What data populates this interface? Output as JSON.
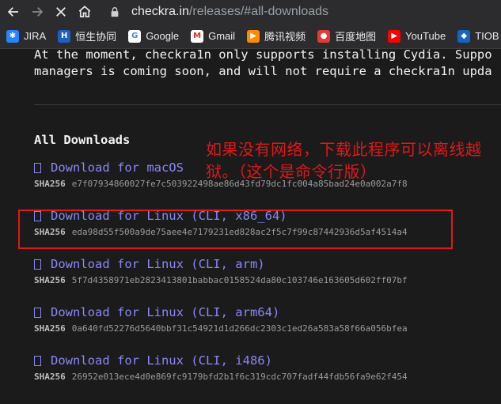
{
  "browser": {
    "url_host": "checkra.in",
    "url_path": "/releases/#all-downloads",
    "bookmarks": [
      {
        "label": "JIRA",
        "icon": "jira-icon",
        "color": "#2684ff",
        "glyph": "✱"
      },
      {
        "label": "恒生协同",
        "icon": "hengsheng-icon",
        "color": "#1f5fbf",
        "glyph": "H"
      },
      {
        "label": "Google",
        "icon": "google-icon",
        "color": "#ffffff",
        "glyph": "G"
      },
      {
        "label": "Gmail",
        "icon": "gmail-icon",
        "color": "#ffffff",
        "glyph": "M"
      },
      {
        "label": "腾讯视频",
        "icon": "tencent-video-icon",
        "color": "#ff8a00",
        "glyph": "▶"
      },
      {
        "label": "百度地图",
        "icon": "baidu-map-icon",
        "color": "#e53935",
        "glyph": "●"
      },
      {
        "label": "YouTube",
        "icon": "youtube-icon",
        "color": "#ff0000",
        "glyph": "▶"
      },
      {
        "label": "TIOB",
        "icon": "tiobe-icon",
        "color": "#1565c0",
        "glyph": "◆"
      }
    ]
  },
  "page": {
    "intro_line1": "At the moment, checkra1n only supports installing Cydia. Suppo",
    "intro_line2": "managers is coming soon, and will not require a checkra1n upda",
    "heading": "All Downloads",
    "annotation": "如果没有网络，下载此程序可以离线越狱。（这个是命令行版）",
    "hash_label": "SHA256",
    "downloads": [
      {
        "label": "Download for macOS",
        "sha256": "e7f07934860027fe7c503922498ae86d43fd79dc1fc004a85bad24e0a002a7f8"
      },
      {
        "label": "Download for Linux (CLI, x86_64)",
        "sha256": "eda98d55f500a9de75aee4e7179231ed828ac2f5c7f99c87442936d5af4514a4"
      },
      {
        "label": "Download for Linux (CLI, arm)",
        "sha256": "5f7d4358971eb2823413801babbac0158524da80c103746e163605d602ff07bf"
      },
      {
        "label": "Download for Linux (CLI, arm64)",
        "sha256": "0a640fd52276d5640bbf31c54921d1d266dc2303c1ed26a583a58f66a056bfea"
      },
      {
        "label": "Download for Linux (CLI, i486)",
        "sha256": "26952e013ece4d0e869fc9179bfd2b1f6c319cdc707fadf44fdb56fa9e62f454"
      }
    ]
  }
}
